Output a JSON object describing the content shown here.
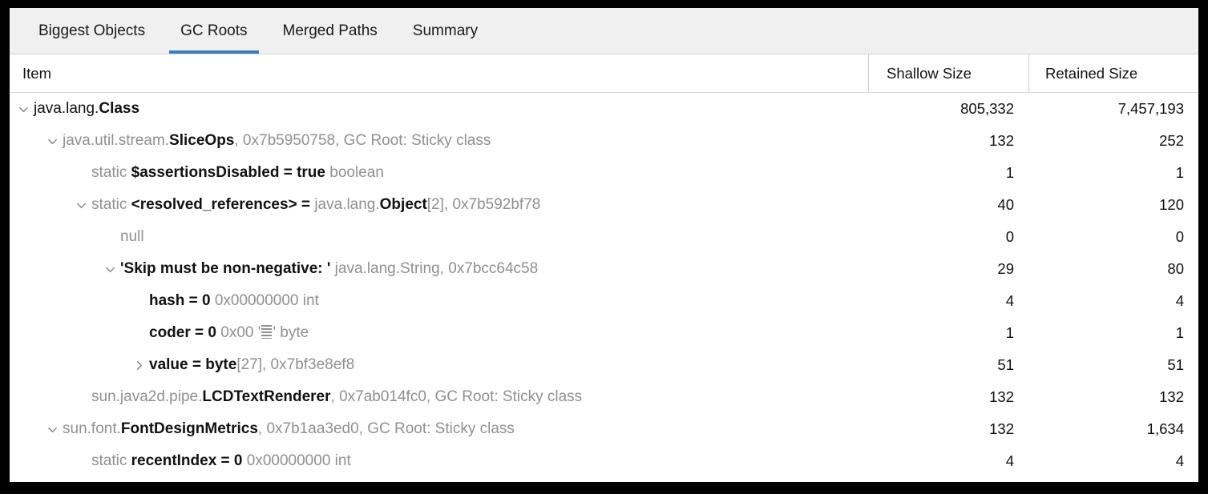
{
  "window": {
    "border_color": "#000000",
    "background": "#ffffff"
  },
  "tabs": {
    "active_index": 1,
    "active_underline_color": "#3c7eb8",
    "items": [
      {
        "label": "Biggest Objects"
      },
      {
        "label": "GC Roots"
      },
      {
        "label": "Merged Paths"
      },
      {
        "label": "Summary"
      }
    ]
  },
  "table": {
    "columns": [
      {
        "key": "item",
        "label": "Item",
        "align": "left"
      },
      {
        "key": "shallow",
        "label": "Shallow Size",
        "align": "right"
      },
      {
        "key": "retained",
        "label": "Retained Size",
        "align": "right"
      }
    ],
    "rows": [
      {
        "depth": 0,
        "twisty": "chevron-down-icon",
        "segments": [
          {
            "text": "java.lang.",
            "style": "plain"
          },
          {
            "text": "Class",
            "style": "name"
          }
        ],
        "shallow": "805,332",
        "retained": "7,457,193"
      },
      {
        "depth": 1,
        "twisty": "chevron-down-icon",
        "segments": [
          {
            "text": "java.util.stream.",
            "style": "dim"
          },
          {
            "text": "SliceOps",
            "style": "name"
          },
          {
            "text": ", 0x7b5950758, GC Root: Sticky class",
            "style": "dim"
          }
        ],
        "shallow": "132",
        "retained": "252"
      },
      {
        "depth": 2,
        "twisty": "none",
        "segments": [
          {
            "text": "static ",
            "style": "dim"
          },
          {
            "text": "$assertionsDisabled = true",
            "style": "name"
          },
          {
            "text": " boolean",
            "style": "dim"
          }
        ],
        "shallow": "1",
        "retained": "1"
      },
      {
        "depth": 2,
        "twisty": "chevron-down-icon",
        "segments": [
          {
            "text": "static ",
            "style": "dim"
          },
          {
            "text": "<resolved_references> = ",
            "style": "name"
          },
          {
            "text": "java.lang.",
            "style": "dim"
          },
          {
            "text": "Object",
            "style": "name"
          },
          {
            "text": "[2], 0x7b592bf78",
            "style": "dim"
          }
        ],
        "shallow": "40",
        "retained": "120"
      },
      {
        "depth": 3,
        "twisty": "none",
        "segments": [
          {
            "text": "null",
            "style": "dim"
          }
        ],
        "shallow": "0",
        "retained": "0"
      },
      {
        "depth": 3,
        "twisty": "chevron-down-icon",
        "segments": [
          {
            "text": "'Skip must be non-negative: '",
            "style": "name"
          },
          {
            "text": " java.lang.String, 0x7bcc64c58",
            "style": "dim"
          }
        ],
        "shallow": "29",
        "retained": "80"
      },
      {
        "depth": 4,
        "twisty": "none",
        "segments": [
          {
            "text": "hash = 0",
            "style": "name"
          },
          {
            "text": " 0x00000000  int",
            "style": "dim"
          }
        ],
        "shallow": "4",
        "retained": "4"
      },
      {
        "depth": 4,
        "twisty": "none",
        "segments": [
          {
            "text": "coder = 0",
            "style": "name"
          },
          {
            "text": " 0x00  '",
            "style": "dim"
          },
          {
            "text": "",
            "style": "ctrlbox"
          },
          {
            "text": "' byte",
            "style": "dim"
          }
        ],
        "shallow": "1",
        "retained": "1"
      },
      {
        "depth": 4,
        "twisty": "chevron-right-icon",
        "segments": [
          {
            "text": "value = byte",
            "style": "name"
          },
          {
            "text": "[27], 0x7bf3e8ef8",
            "style": "dim"
          }
        ],
        "shallow": "51",
        "retained": "51"
      },
      {
        "depth": 2,
        "twisty": "none",
        "segments": [
          {
            "text": "sun.java2d.pipe.",
            "style": "dim"
          },
          {
            "text": "LCDTextRenderer",
            "style": "name"
          },
          {
            "text": ", 0x7ab014fc0, GC Root: Sticky class",
            "style": "dim"
          }
        ],
        "shallow": "132",
        "retained": "132"
      },
      {
        "depth": 1,
        "twisty": "chevron-down-icon",
        "segments": [
          {
            "text": "sun.font.",
            "style": "dim"
          },
          {
            "text": "FontDesignMetrics",
            "style": "name"
          },
          {
            "text": ", 0x7b1aa3ed0, GC Root: Sticky class",
            "style": "dim"
          }
        ],
        "shallow": "132",
        "retained": "1,634"
      },
      {
        "depth": 2,
        "twisty": "none",
        "segments": [
          {
            "text": "static ",
            "style": "dim"
          },
          {
            "text": "recentIndex = 0",
            "style": "name"
          },
          {
            "text": " 0x00000000  int",
            "style": "dim"
          }
        ],
        "shallow": "4",
        "retained": "4"
      }
    ]
  }
}
